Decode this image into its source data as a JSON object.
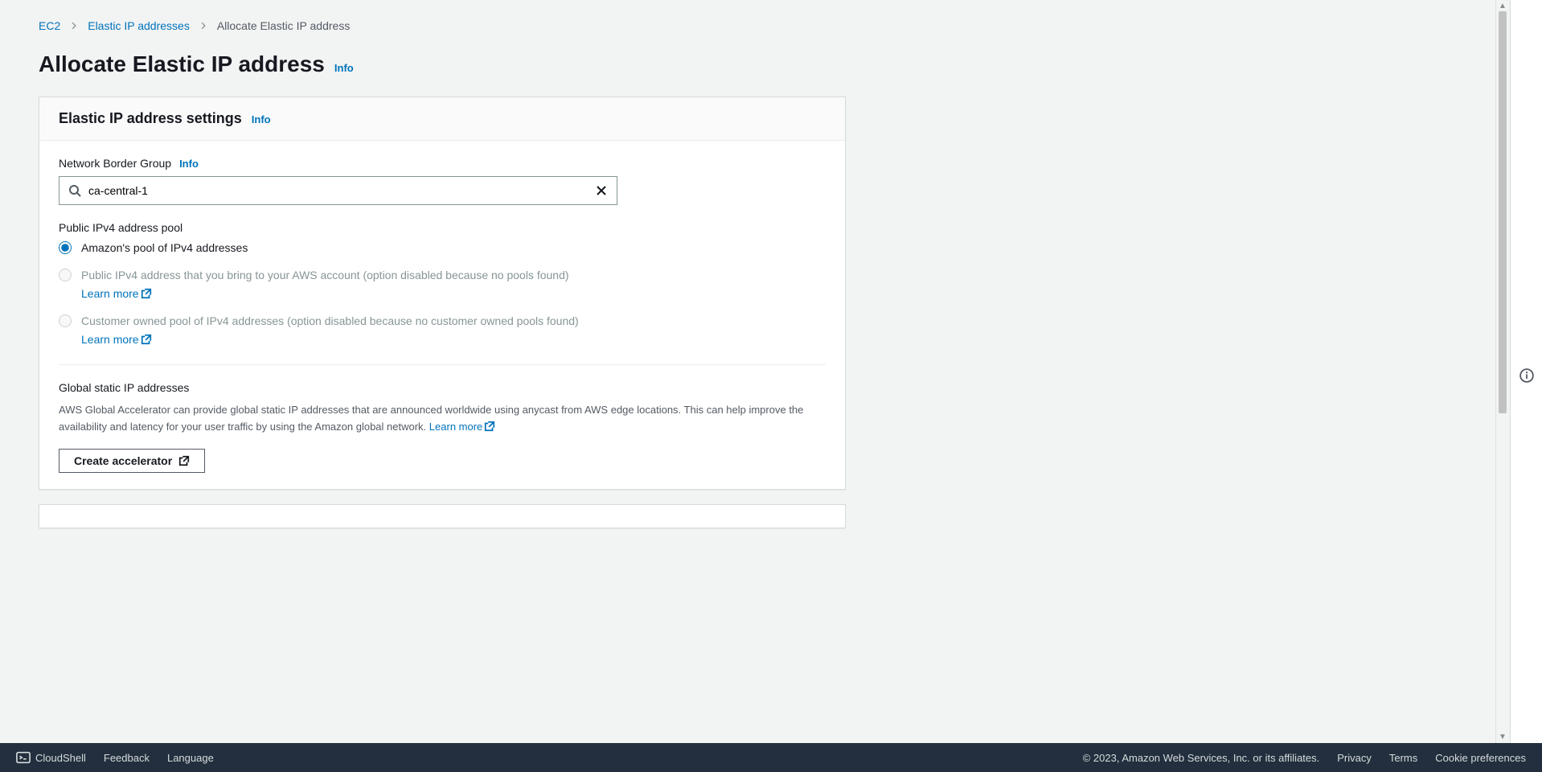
{
  "breadcrumb": {
    "items": [
      "EC2",
      "Elastic IP addresses",
      "Allocate Elastic IP address"
    ]
  },
  "page": {
    "title": "Allocate Elastic IP address",
    "info": "Info"
  },
  "settings_panel": {
    "title": "Elastic IP address settings",
    "info": "Info",
    "network_border_group": {
      "label": "Network Border Group",
      "info": "Info",
      "value": "ca-central-1"
    },
    "pool": {
      "title": "Public IPv4 address pool",
      "options": [
        {
          "text": "Amazon's pool of IPv4 addresses",
          "disabled": false,
          "learn_more": null
        },
        {
          "text": "Public IPv4 address that you bring to your AWS account (option disabled because no pools found) ",
          "disabled": true,
          "learn_more": "Learn more"
        },
        {
          "text": "Customer owned pool of IPv4 addresses (option disabled because no customer owned pools found) ",
          "disabled": true,
          "learn_more": "Learn more"
        }
      ]
    },
    "global": {
      "title": "Global static IP addresses",
      "description": "AWS Global Accelerator can provide global static IP addresses that are announced worldwide using anycast from AWS edge locations. This can help improve the availability and latency for your user traffic by using the Amazon global network. ",
      "learn_more": "Learn more",
      "button": "Create accelerator"
    }
  },
  "footer": {
    "cloudshell": "CloudShell",
    "feedback": "Feedback",
    "language": "Language",
    "copyright": "© 2023, Amazon Web Services, Inc. or its affiliates.",
    "privacy": "Privacy",
    "terms": "Terms",
    "cookies": "Cookie preferences"
  }
}
